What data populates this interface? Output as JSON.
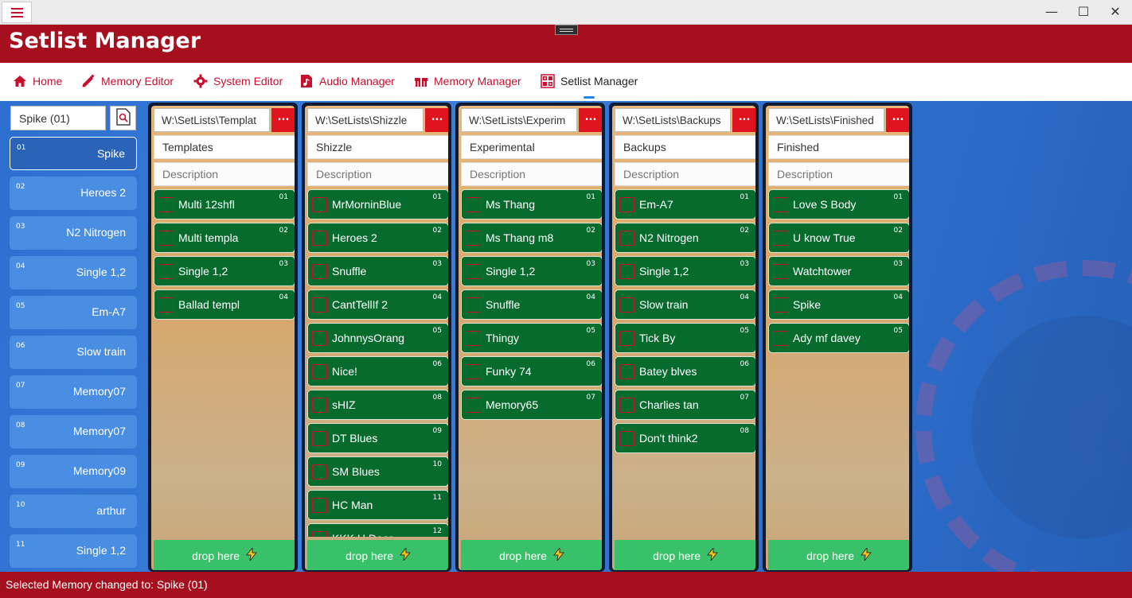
{
  "window": {
    "min": "—",
    "max": "☐",
    "close": "✕"
  },
  "app": {
    "title": "Setlist Manager"
  },
  "nav": [
    {
      "label": "Home",
      "icon": "home-icon"
    },
    {
      "label": "Memory Editor",
      "icon": "pencil-icon"
    },
    {
      "label": "System Editor",
      "icon": "gear-icon"
    },
    {
      "label": "Audio Manager",
      "icon": "music-file-icon"
    },
    {
      "label": "Memory Manager",
      "icon": "gift-icon"
    },
    {
      "label": "Setlist Manager",
      "icon": "grid-icon",
      "active": true
    }
  ],
  "sidebar": {
    "search_value": "Spike (01)",
    "items": [
      {
        "num": "01",
        "name": "Spike",
        "selected": true
      },
      {
        "num": "02",
        "name": "Heroes 2"
      },
      {
        "num": "03",
        "name": "N2 Nitrogen"
      },
      {
        "num": "04",
        "name": "Single 1,2"
      },
      {
        "num": "05",
        "name": "Em-A7"
      },
      {
        "num": "06",
        "name": "Slow train"
      },
      {
        "num": "07",
        "name": "Memory07"
      },
      {
        "num": "08",
        "name": "Memory07"
      },
      {
        "num": "09",
        "name": "Memory09"
      },
      {
        "num": "10",
        "name": "arthur"
      },
      {
        "num": "11",
        "name": "Single 1,2"
      }
    ]
  },
  "setlists": [
    {
      "path": "W:\\SetLists\\Templat",
      "name": "Templates",
      "description_placeholder": "Description",
      "more": "...",
      "drop": "drop here",
      "songs": [
        {
          "num": "01",
          "name": "Multi 12shfl"
        },
        {
          "num": "02",
          "name": "Multi templa"
        },
        {
          "num": "03",
          "name": "Single 1,2"
        },
        {
          "num": "04",
          "name": "Ballad templ"
        }
      ]
    },
    {
      "path": "W:\\SetLists\\Shizzle",
      "name": "Shizzle",
      "description_placeholder": "Description",
      "more": "...",
      "drop": "drop here",
      "songs": [
        {
          "num": "01",
          "name": "MrMorninBlue"
        },
        {
          "num": "02",
          "name": "Heroes 2"
        },
        {
          "num": "03",
          "name": "Snuffle"
        },
        {
          "num": "04",
          "name": "CantTellIf 2"
        },
        {
          "num": "05",
          "name": "JohnnysOrang"
        },
        {
          "num": "06",
          "name": "Nice!"
        },
        {
          "num": "08",
          "name": "sHIZ"
        },
        {
          "num": "09",
          "name": "DT Blues"
        },
        {
          "num": "10",
          "name": "SM Blues"
        },
        {
          "num": "11",
          "name": "HC Man"
        },
        {
          "num": "12",
          "name": "KKK H Door"
        }
      ]
    },
    {
      "path": "W:\\SetLists\\Experim",
      "name": "Experimental",
      "description_placeholder": "Description",
      "more": "...",
      "drop": "drop here",
      "songs": [
        {
          "num": "01",
          "name": "Ms Thang"
        },
        {
          "num": "02",
          "name": "Ms Thang m8"
        },
        {
          "num": "03",
          "name": "Single 1,2"
        },
        {
          "num": "04",
          "name": "Snuffle"
        },
        {
          "num": "05",
          "name": "Thingy"
        },
        {
          "num": "06",
          "name": "Funky 74"
        },
        {
          "num": "07",
          "name": "Memory65"
        }
      ]
    },
    {
      "path": "W:\\SetLists\\Backups",
      "name": "Backups",
      "description_placeholder": "Description",
      "more": "...",
      "drop": "drop here",
      "songs": [
        {
          "num": "01",
          "name": "Em-A7"
        },
        {
          "num": "02",
          "name": "N2 Nitrogen"
        },
        {
          "num": "03",
          "name": "Single 1,2"
        },
        {
          "num": "04",
          "name": "Slow train"
        },
        {
          "num": "05",
          "name": "Tick By"
        },
        {
          "num": "06",
          "name": "Batey blves"
        },
        {
          "num": "07",
          "name": "Charlies tan"
        },
        {
          "num": "08",
          "name": "Don't think2"
        }
      ]
    },
    {
      "path": "W:\\SetLists\\Finished",
      "name": "Finished",
      "description_placeholder": "Description",
      "more": "...",
      "drop": "drop here",
      "songs": [
        {
          "num": "01",
          "name": "Love S Body"
        },
        {
          "num": "02",
          "name": "U know True"
        },
        {
          "num": "03",
          "name": "Watchtower"
        },
        {
          "num": "04",
          "name": "Spike"
        },
        {
          "num": "05",
          "name": "Ady mf davey"
        }
      ]
    }
  ],
  "status": {
    "text": "Selected Memory changed to: Spike (01)"
  },
  "colors": {
    "brand_red": "#a50f1e",
    "song_green": "#076b2e",
    "drop_green": "#39c16a",
    "accent_blue": "#1e88e5"
  }
}
